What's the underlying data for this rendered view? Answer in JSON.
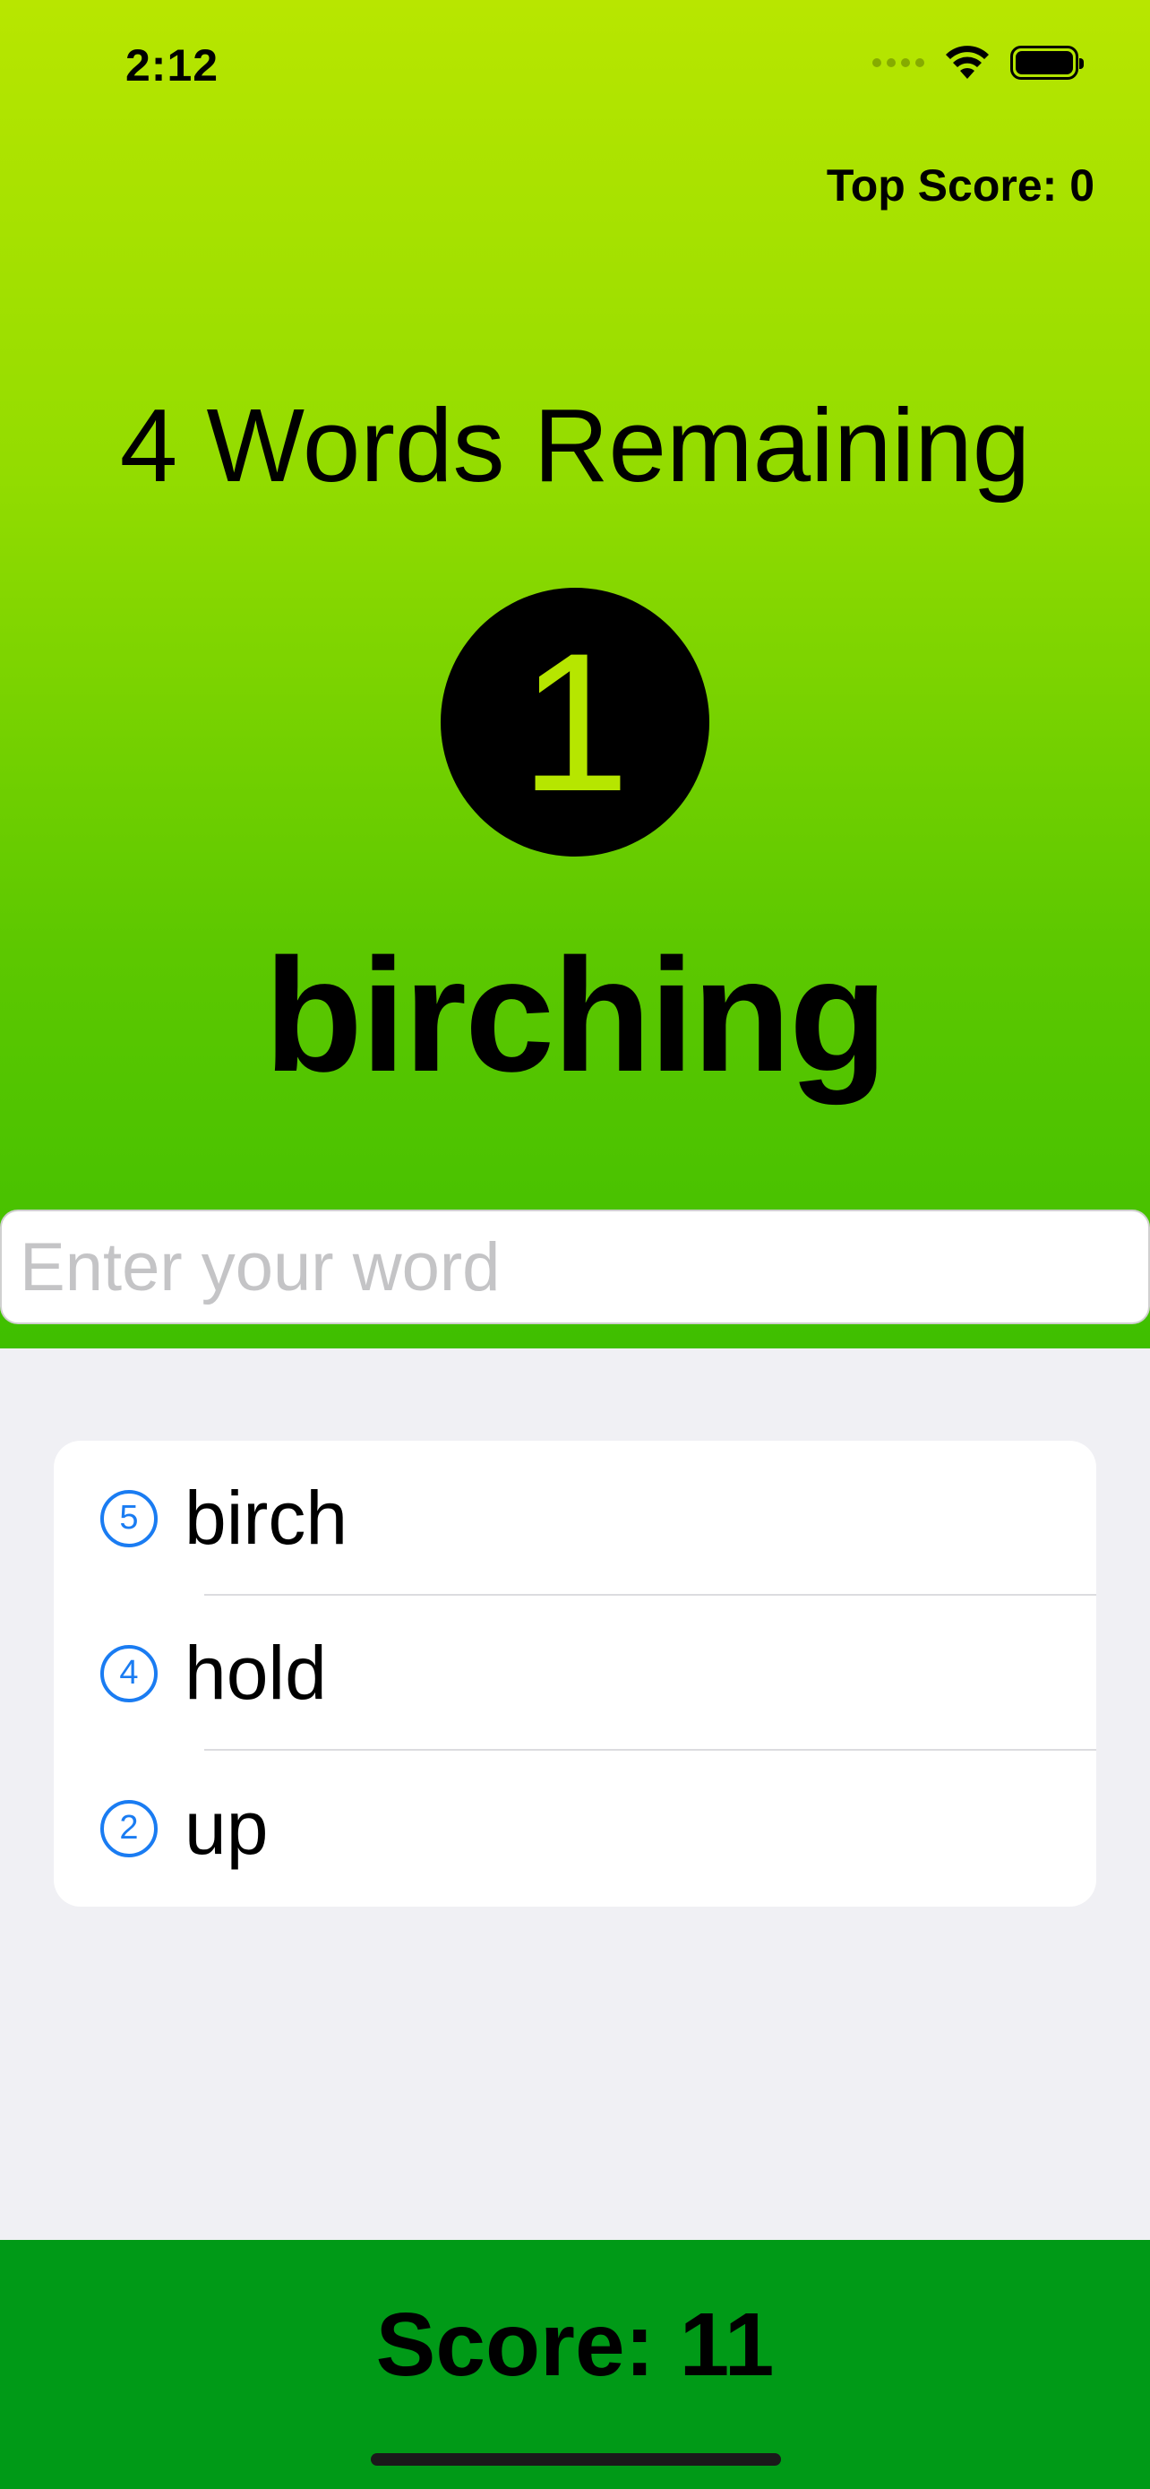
{
  "status_bar": {
    "time": "2:12"
  },
  "header": {
    "top_score": "Top Score: 0"
  },
  "game": {
    "remaining": "4 Words Remaining",
    "counter": "1",
    "current_word": "birching"
  },
  "input": {
    "placeholder": "Enter your word",
    "value": ""
  },
  "words": [
    {
      "points": "5",
      "word": "birch"
    },
    {
      "points": "4",
      "word": "hold"
    },
    {
      "points": "2",
      "word": "up"
    }
  ],
  "footer": {
    "score": "Score: 11"
  },
  "colors": {
    "gradient_top": "#b8e600",
    "gradient_bottom": "#3fbf00",
    "footer": "#009a17",
    "badge_blue": "#1a7cf2",
    "counter_digit": "#b6e600"
  }
}
